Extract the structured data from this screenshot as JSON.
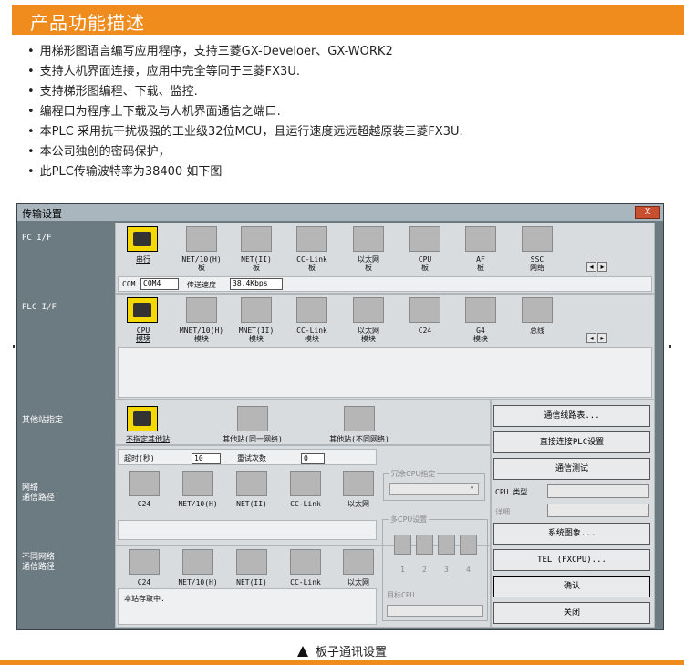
{
  "heading": "产品功能描述",
  "bullets": [
    "用梯形图语言编写应用程序，支持三菱GX-Develoer、GX-WORK2",
    "支持人机界面连接，应用中完全等同于三菱FX3U.",
    "支持梯形图编程、下载、监控.",
    "编程口为程序上下载及与人机界面通信之端口.",
    "本PLC 采用抗干扰极强的工业级32位MCU，且运行速度远远超越原装三菱FX3U.",
    "本公司独创的密码保护，",
    "此PLC传输波特率为38400 如下图"
  ],
  "dialog": {
    "title": "传输设置",
    "close": "X",
    "labels": {
      "pc_if": "PC I/F",
      "plc_if": "PLC I/F",
      "other_station": "其他站指定",
      "network_route": [
        "网络",
        "通信路径"
      ],
      "diff_network_route": [
        "不同网络",
        "通信路径"
      ]
    },
    "pc_items": [
      [
        "串行"
      ],
      [
        "NET/10(H)",
        "板"
      ],
      [
        "NET(II)",
        "板"
      ],
      [
        "CC-Link",
        "板"
      ],
      [
        "以太网",
        "板"
      ],
      [
        "CPU",
        "板"
      ],
      [
        "AF",
        "板"
      ],
      [
        "SSC",
        "网络"
      ]
    ],
    "com_bar": {
      "com_label": "COM",
      "com_value": "COM4",
      "speed_label": "传送速度",
      "speed_value": "38.4Kbps"
    },
    "plc_items": [
      [
        "CPU",
        "模块"
      ],
      [
        "MNET/10(H)",
        "模块"
      ],
      [
        "MNET(II)",
        "模块"
      ],
      [
        "CC-Link",
        "模块"
      ],
      [
        "以太网",
        "模块"
      ],
      [
        "C24"
      ],
      [
        "G4",
        "模块"
      ],
      [
        "总线"
      ]
    ],
    "other_items": [
      "不指定其他站",
      "其他站(同一网络)",
      "其他站(不同网络)"
    ],
    "timeout_label": "超时(秒)",
    "timeout_value": "10",
    "retry_label": "重试次数",
    "retry_value": "0",
    "net_items": [
      "C24",
      "NET/10(H)",
      "NET(II)",
      "CC-Link",
      "以太网"
    ],
    "diff_items": [
      "C24",
      "NET/10(H)",
      "NET(II)",
      "CC-Link",
      "以太网"
    ],
    "status_text": "本站存取中.",
    "redundant_cpu": "冗余CPU指定",
    "multi_cpu": "多CPU设置",
    "multi_cpu_nums": [
      "1",
      "2",
      "3",
      "4"
    ],
    "target_cpu": "目标CPU",
    "cpu_type_label": "CPU 类型",
    "detail_label": "详细",
    "buttons": {
      "route_table": "通信线路表...",
      "direct_plc": "直接连接PLC设置",
      "comm_test": "通信测试",
      "system_image": "系统图象...",
      "tel": "TEL (FXCPU)...",
      "ok": "确认",
      "close": "关闭"
    }
  },
  "caption": "板子通讯设置"
}
